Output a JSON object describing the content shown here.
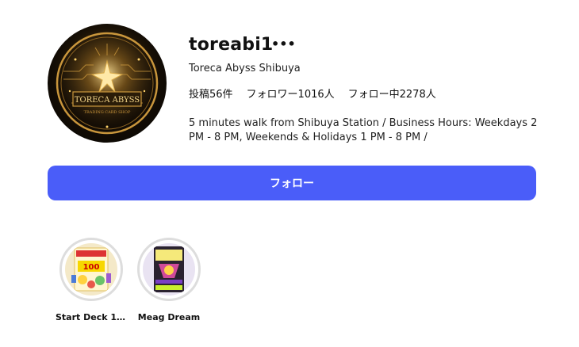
{
  "profile": {
    "username": "toreabi1",
    "more_icon": "•••",
    "display_name": "Toreca Abyss Shibuya",
    "stats": {
      "posts": "投稿56件",
      "followers": "フォロワー1016人",
      "following": "フォロー中2278人"
    },
    "bio": "5 minutes walk from Shibuya Station / Business Hours: Weekdays 2 PM - 8 PM, Weekends & Holidays 1 PM - 8 PM /",
    "avatar_logo_text": "TORECA ABYSS",
    "avatar_logo_subtext": "TRADING CARD SHOP"
  },
  "follow_button": {
    "label": "フォロー",
    "color": "#4a5df9"
  },
  "highlights": [
    {
      "label": "Start Deck 10...",
      "icon": "trading-card-box-thumbnail"
    },
    {
      "label": "Meag Dream",
      "icon": "card-pack-thumbnail"
    }
  ]
}
